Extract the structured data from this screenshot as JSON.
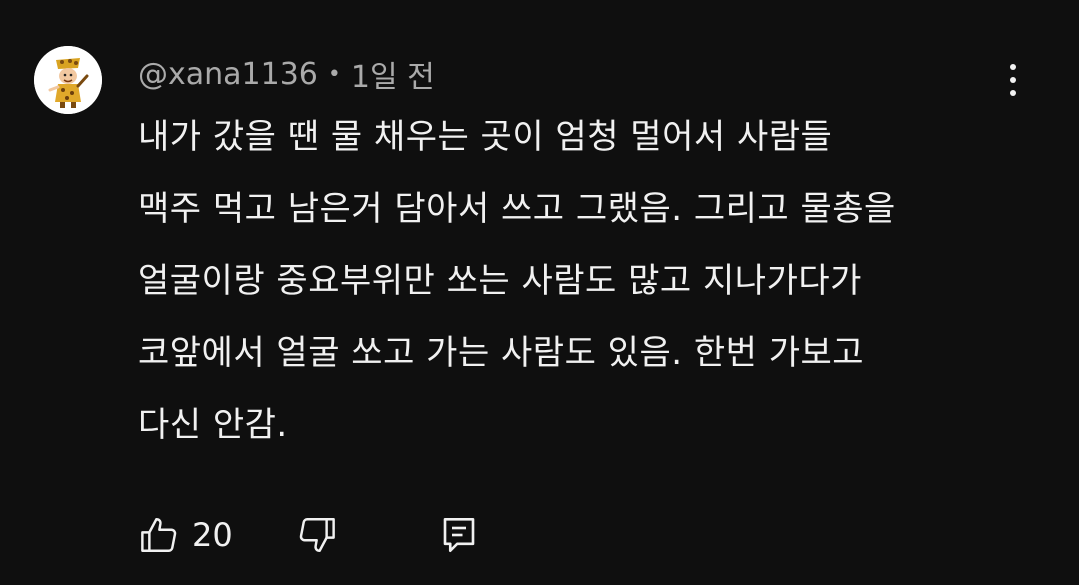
{
  "comment": {
    "author": "@xana1136",
    "separator": "•",
    "time": "1일 전",
    "lines": [
      "내가 갔을 땐 물 채우는 곳이 엄청 멀어서 사람들",
      "맥주 먹고 남은거 담아서 쓰고 그랬음. 그리고 물총을",
      "얼굴이랑 중요부위만 쏘는 사람도 많고 지나가다가",
      "코앞에서 얼굴 쏘고 가는 사람도 있음. 한번 가보고",
      "다신 안감."
    ],
    "like_count": "20"
  },
  "icons": {
    "avatar": "cartoon-character-avatar",
    "more": "vertical-ellipsis-icon",
    "like": "thumbs-up-icon",
    "dislike": "thumbs-down-icon",
    "reply": "reply-comment-icon"
  },
  "colors": {
    "background": "#0f0f0f",
    "text_primary": "#f1f1f1",
    "text_secondary": "#aaaaaa"
  }
}
